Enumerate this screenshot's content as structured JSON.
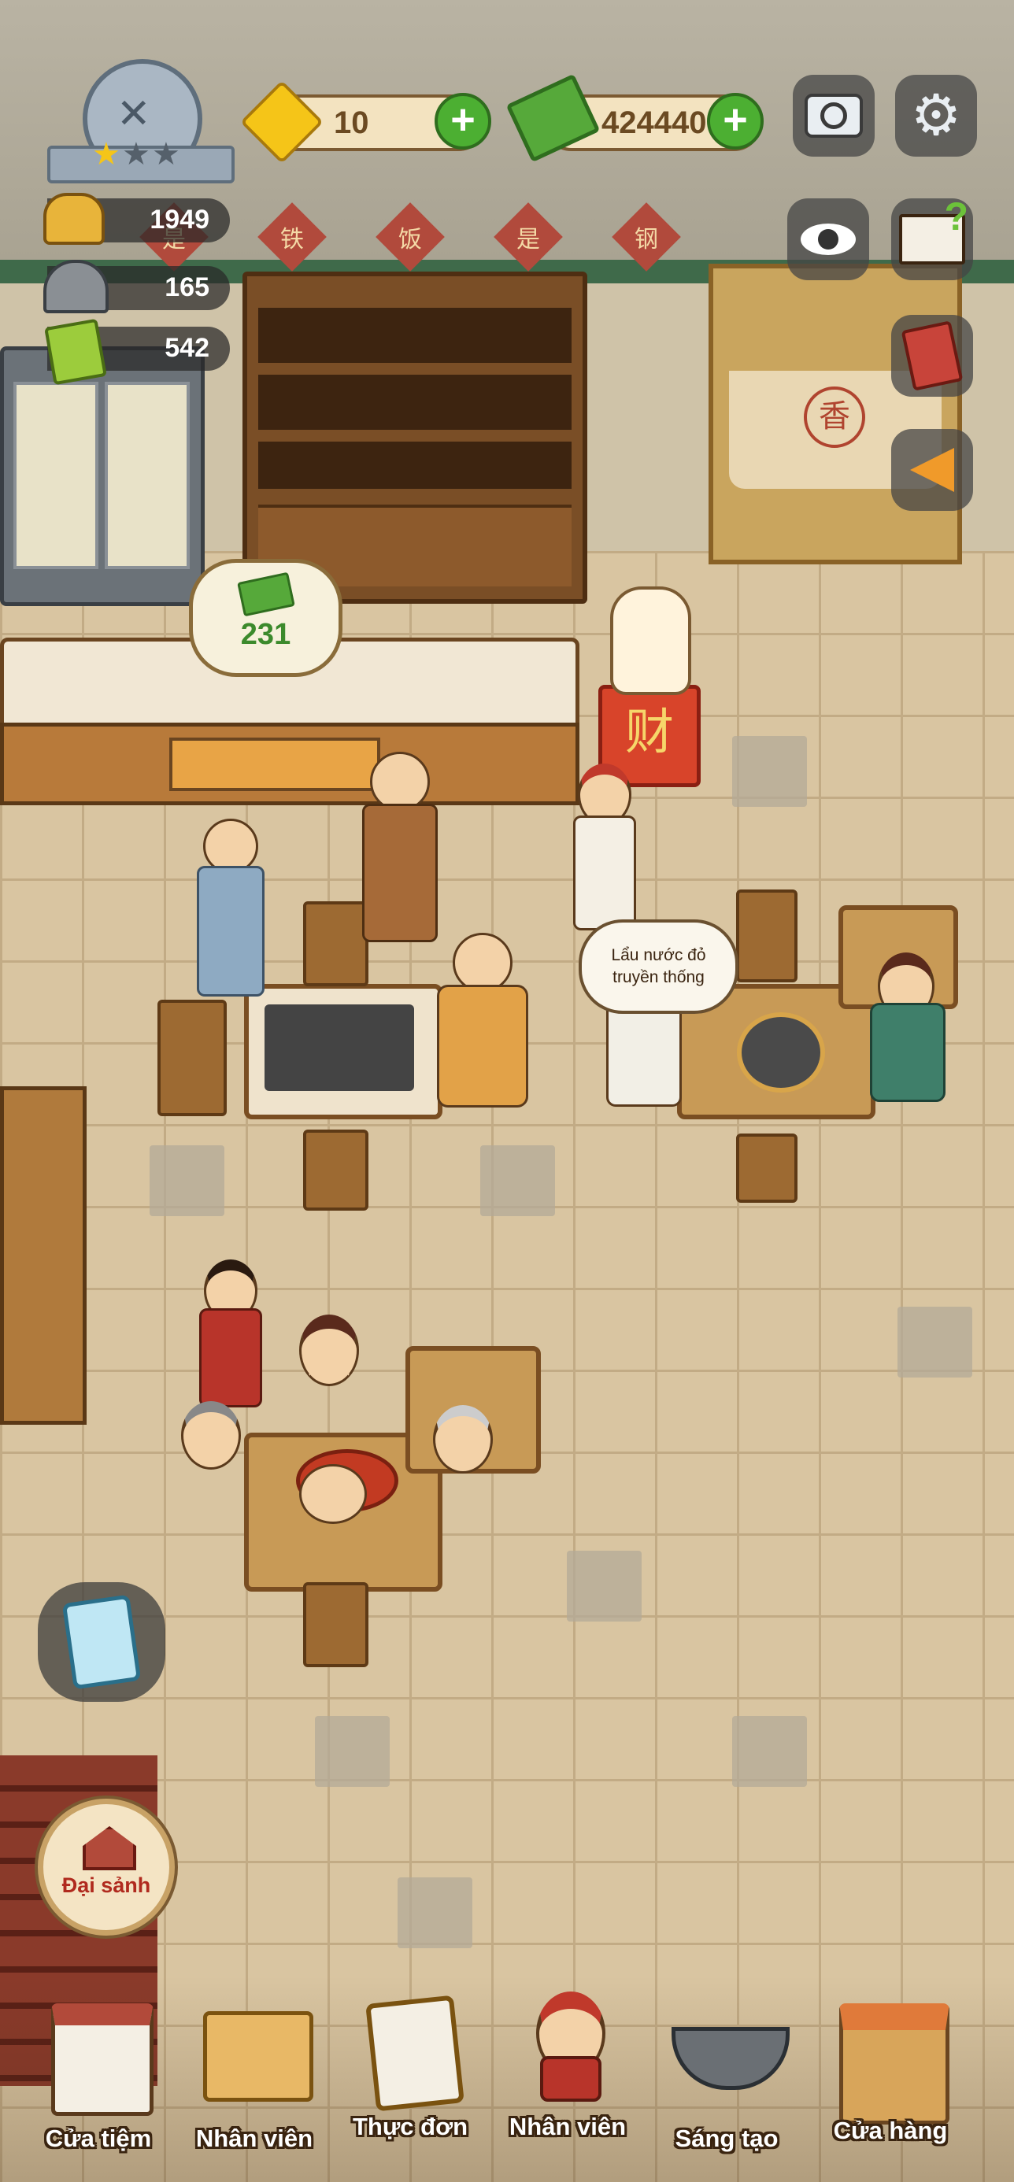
{
  "hud": {
    "gems": "10",
    "cash": "424440",
    "stats": [
      "1949",
      "165",
      "542"
    ]
  },
  "counter": {
    "tip": "231"
  },
  "speech": {
    "text": "Lẩu nước đỏ truyền thống"
  },
  "signs": {
    "fortune": "财",
    "door": "香",
    "banner": [
      "是",
      "铁",
      "饭",
      "是",
      "钢"
    ]
  },
  "hall_button": {
    "label": "Đại sảnh"
  },
  "nav": [
    {
      "label": "Cửa tiệm",
      "icon": "shop-house-icon"
    },
    {
      "label": "Nhân viên",
      "icon": "boxes-icon"
    },
    {
      "label": "Thực đơn",
      "icon": "menu-clipboard-icon"
    },
    {
      "label": "Nhân viên",
      "icon": "waitress-icon"
    },
    {
      "label": "Sáng tạo",
      "icon": "wok-icon"
    },
    {
      "label": "Cửa hàng",
      "icon": "market-stall-icon"
    }
  ],
  "colors": {
    "accent": "#4caf32",
    "nav_text": "#ffffff",
    "floor": "#d9c5a1"
  }
}
